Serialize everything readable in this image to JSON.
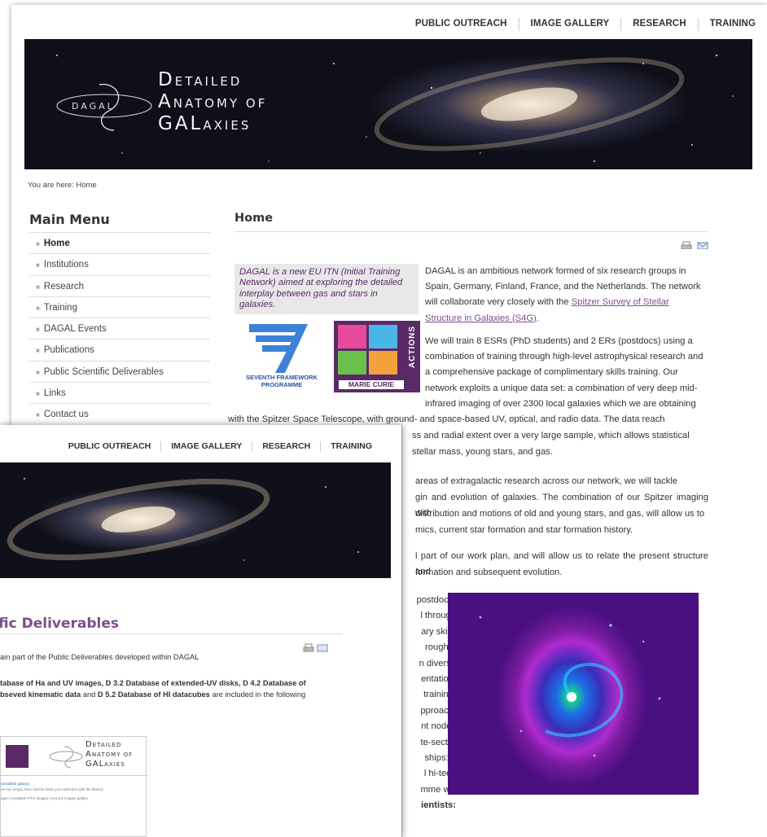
{
  "back_page": {
    "top_nav": [
      "PUBLIC OUTREACH",
      "IMAGE GALLERY",
      "RESEARCH",
      "TRAINING"
    ],
    "logo": {
      "line1": {
        "cap": "D",
        "rest": "ETAILED"
      },
      "line2": {
        "cap": "A",
        "rest": "NATOMY OF"
      },
      "line3": {
        "cap": "GAL",
        "rest": "AXIES"
      },
      "mark_text": "DAGAL"
    },
    "breadcrumb": "You are here: Home",
    "sidebar": {
      "title": "Main Menu",
      "items": [
        {
          "label": "Home",
          "active": true
        },
        {
          "label": "Institutions"
        },
        {
          "label": "Research"
        },
        {
          "label": "Training"
        },
        {
          "label": "DAGAL Events"
        },
        {
          "label": "Publications"
        },
        {
          "label": "Public Scientific Deliverables"
        },
        {
          "label": "Links"
        },
        {
          "label": "Contact us"
        }
      ]
    },
    "main": {
      "title": "Home",
      "intro": "DAGAL is a new EU ITN (Initial Training Network) aimed at exploring the detailed interplay between gas and stars in galaxies.",
      "fp7_label_1": "SEVENTH FRAMEWORK",
      "fp7_label_2": "PROGRAMME",
      "marie_vertical": "ACTIONS",
      "marie_bottom": "MARIE CURIE",
      "p1_lines": [
        "DAGAL is an ambitious network formed of six research groups in",
        "Spain, Germany, Finland, France, and the Netherlands. The network",
        "will collaborate very closely with the"
      ],
      "p1_link_a": "Spitzer Survey of Stellar",
      "p1_link_b": "Structure in Galaxies (S4G)",
      "p2_lines": [
        "We will train 8 ESRs (PhD students) and 2 ERs (postdocs) using a",
        "combination of training through high-level astrophysical research and",
        "a comprehensive package of complimentary skills training. Our",
        "network exploits a unique data set: a combination of very deep mid-",
        "infrared imaging of over 2300 local galaxies which we are obtaining"
      ],
      "p2_full": "with the Spitzer Space Telescope, with ground- and space-based UV, optical, and radio data. The data reach",
      "p2_tail_1": "ss and radial extent over a very large sample, which allows statistical",
      "p2_tail_2": "stellar mass, young stars, and gas.",
      "p3_1": "areas of extragalactic research across our network, we will tackle",
      "p3_2": "gin and evolution of galaxies. The combination of our Spitzer imaging with",
      "p3_3": "distribution and motions of old and young stars, and gas, will allow us to",
      "p3_4": "mics, current star formation and star formation history.",
      "p4_1": "l part of our work plan, and will allow us to relate the present structure and",
      "p4_2": "formation and subsequent evolution.",
      "p5_lines": [
        "postdocs)",
        "l through",
        "ary skills",
        "rough a",
        "n diverse",
        "entation,",
        "training.",
        "pproach.",
        "nt nodes",
        "te-sector",
        "ships: a",
        "l hi-tech",
        "mme will",
        "ientists:"
      ]
    }
  },
  "front_page": {
    "top_nav": [
      "PUBLIC OUTREACH",
      "IMAGE GALLERY",
      "RESEARCH",
      "TRAINING"
    ],
    "title": "fic Deliverables",
    "p1": "ain part of the Public Deliverables developed within DAGAL",
    "p2_bold_1": "tabase of Ha and UV images, D 3.2 Database of extended-UV disks, D 4.2 Database of",
    "p2_bold_2": "bseved kinematic data",
    "p2_mid": " and ",
    "p2_bold_3": "D 5.2 Database of HI datacubes",
    "p2_end": " are included in the following",
    "thumb_logo": {
      "line1": {
        "cap": "D",
        "rest": "ETAILED"
      },
      "line2": {
        "cap": "A",
        "rest": "NATOMY OF"
      },
      "line3": {
        "cap": "GAL",
        "rest": "AXIES"
      }
    },
    "thumb_text_1": "(available galaxy)",
    "thumb_text_2": "ne box empty, then narrow down your selection with the filters!)",
    "thumb_text_3": "ages | Available FITS images | GALEX images gallery"
  },
  "colors": {
    "accent": "#7a4f8a",
    "intro_text": "#5a2a66"
  }
}
